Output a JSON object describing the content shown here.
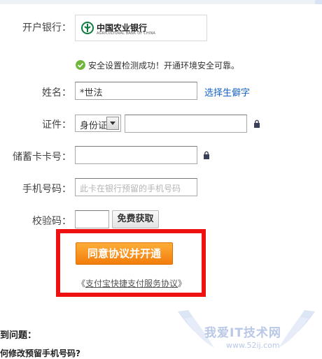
{
  "form": {
    "bank_label": "开户银行：",
    "bank_logo_cn": "中国农业银行",
    "bank_logo_en": "AGRICULTURAL BANK OF CHINA",
    "security_message": "安全设置检测成功！开通环境安全可靠。",
    "name_label": "姓名：",
    "name_value": "*世法",
    "rare_char_link": "选择生僻字",
    "id_label": "证件：",
    "id_type": "身份证",
    "id_number": "",
    "card_label": "储蓄卡卡号：",
    "card_number": "",
    "phone_label": "手机号码：",
    "phone_placeholder": "此卡在银行预留的手机号码",
    "code_label": "校验码：",
    "code_value": "",
    "get_code_button": "免费获取",
    "submit_button": "同意协议并开通",
    "agreement_open": "《",
    "agreement_link": "支付宝快捷支付服务协议",
    "agreement_close": "》"
  },
  "help": {
    "title": "遇到问题：",
    "question": "如何修改预留手机号码?"
  },
  "watermark": {
    "text": "我爱IT技术网",
    "url": "www.52ij.com"
  },
  "colors": {
    "highlight": "#ee1111",
    "primary_button": "#f5870f",
    "link": "#1764c4",
    "success": "#6fb63a"
  },
  "icons": [
    "check-circle-icon",
    "lock-icon",
    "dropdown-arrow-icon",
    "bank-logo-icon"
  ]
}
